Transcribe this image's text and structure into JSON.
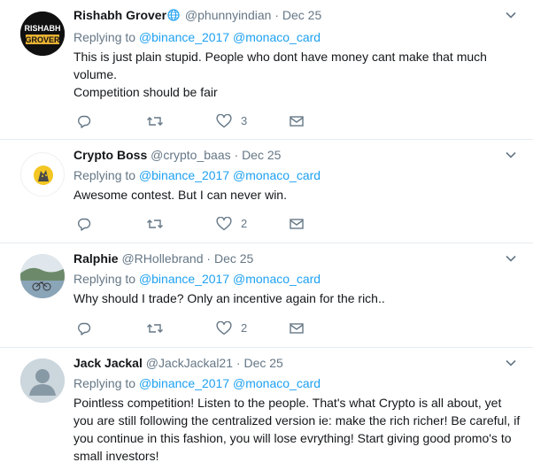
{
  "tweets": [
    {
      "name": "Rishabh Grover",
      "handle": "@phunnyindian",
      "separator": "·",
      "time": "Dec 25",
      "replying_label": "Replying to",
      "mentions": [
        "@binance_2017",
        "@monaco_card"
      ],
      "text_lines": [
        "This is just plain stupid. People who dont have money cant make that much volume.",
        "Competition should be fair"
      ],
      "avatar_text": [
        "RISHABH",
        "GROVER"
      ],
      "reply_count": "",
      "retweet_count": "",
      "like_count": "3",
      "has_globe_icon": true
    },
    {
      "name": "Crypto Boss",
      "handle": "@crypto_baas",
      "separator": "·",
      "time": "Dec 25",
      "replying_label": "Replying to",
      "mentions": [
        "@binance_2017",
        "@monaco_card"
      ],
      "text_lines": [
        "Awesome contest. But I can never win."
      ],
      "reply_count": "",
      "retweet_count": "",
      "like_count": "2"
    },
    {
      "name": "Ralphie",
      "handle": "@RHollebrand",
      "separator": "·",
      "time": "Dec 25",
      "replying_label": "Replying to",
      "mentions": [
        "@binance_2017",
        "@monaco_card"
      ],
      "text_lines": [
        "Why should I trade? Only an incentive again for the rich.."
      ],
      "reply_count": "",
      "retweet_count": "",
      "like_count": "2"
    },
    {
      "name": "Jack Jackal",
      "handle": "@JackJackal21",
      "separator": "·",
      "time": "Dec 25",
      "replying_label": "Replying to",
      "mentions": [
        "@binance_2017",
        "@monaco_card"
      ],
      "text_lines": [
        "Pointless competition! Listen to the people. That's what Crypto is all about, yet you are still following the centralized version ie: make the rich richer! Be careful, if you continue in this fashion, you will lose evrything! Start giving good promo's to small investors!"
      ]
    }
  ],
  "colors": {
    "link": "#1da1f2",
    "secondary_text": "#657786",
    "primary_text": "#14171a",
    "divider": "#e6ecf0"
  },
  "icons": {
    "reply": "speech-bubble-icon",
    "retweet": "retweet-icon",
    "like": "heart-icon",
    "dm": "envelope-icon",
    "caret": "chevron-down-icon",
    "globe": "globe-icon"
  }
}
